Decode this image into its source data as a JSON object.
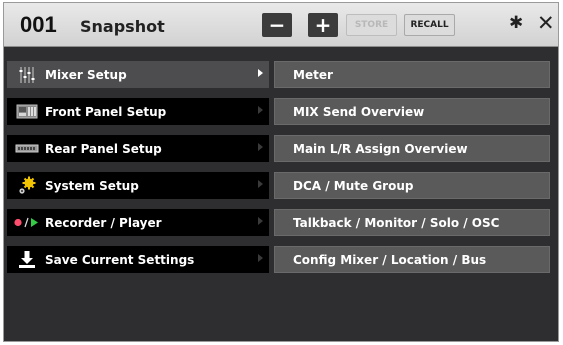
{
  "header": {
    "scene_number": "001",
    "scene_name": "Snapshot",
    "minus_label": "−",
    "plus_label": "+",
    "store_label": "STORE",
    "recall_label": "RECALL"
  },
  "icons": {
    "settings": "gear-icon",
    "close": "close-icon"
  },
  "main_menu": [
    {
      "label": "Mixer Setup",
      "icon": "mixer-faders-icon",
      "active": true
    },
    {
      "label": "Front Panel Setup",
      "icon": "front-panel-icon",
      "active": false
    },
    {
      "label": "Rear Panel Setup",
      "icon": "rear-panel-icon",
      "active": false
    },
    {
      "label": "System Setup",
      "icon": "system-gears-icon",
      "active": false
    },
    {
      "label": "Recorder / Player",
      "icon": "record-play-icon",
      "active": false
    },
    {
      "label": "Save Current Settings",
      "icon": "save-download-icon",
      "active": false
    }
  ],
  "sub_menu": [
    {
      "label": "Meter"
    },
    {
      "label": "MIX Send Overview"
    },
    {
      "label": "Main L/R Assign Overview"
    },
    {
      "label": "DCA / Mute Group"
    },
    {
      "label": "Talkback / Monitor / Solo / OSC"
    },
    {
      "label": "Config Mixer / Location / Bus"
    }
  ],
  "colors": {
    "background": "#2e2e30",
    "active_item": "#4d4d4f",
    "submenu_item": "#5a5a5a",
    "record_red": "#ff4d6d",
    "play_green": "#33cc44",
    "system_yellow": "#f2c300"
  }
}
